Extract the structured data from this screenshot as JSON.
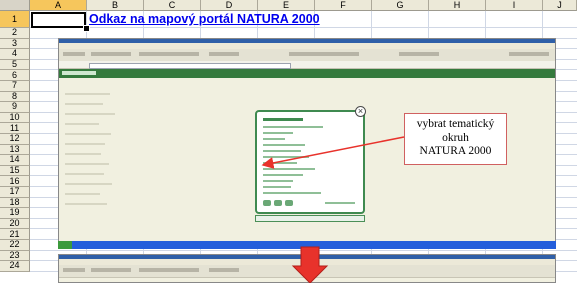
{
  "spreadsheet": {
    "columns": [
      "A",
      "B",
      "C",
      "D",
      "E",
      "F",
      "G",
      "H",
      "I",
      "J"
    ],
    "rows": [
      "1",
      "2",
      "3",
      "4",
      "5",
      "6",
      "7",
      "8",
      "9",
      "10",
      "11",
      "12",
      "13",
      "14",
      "15",
      "16",
      "17",
      "18",
      "19",
      "20",
      "21",
      "22",
      "23",
      "24"
    ],
    "selected_cell": "A1",
    "link_text": "Odkaz na mapový portál NATURA 2000"
  },
  "callout": {
    "line1": "vybrat tematický",
    "line2": "okruh",
    "line3": "NATURA 2000"
  },
  "colors": {
    "header_bg": "#ece9d8",
    "selected_header": "#f6c65c",
    "link": "#0000ee",
    "portal_green": "#357a3d",
    "arrow_red": "#e8322b"
  }
}
